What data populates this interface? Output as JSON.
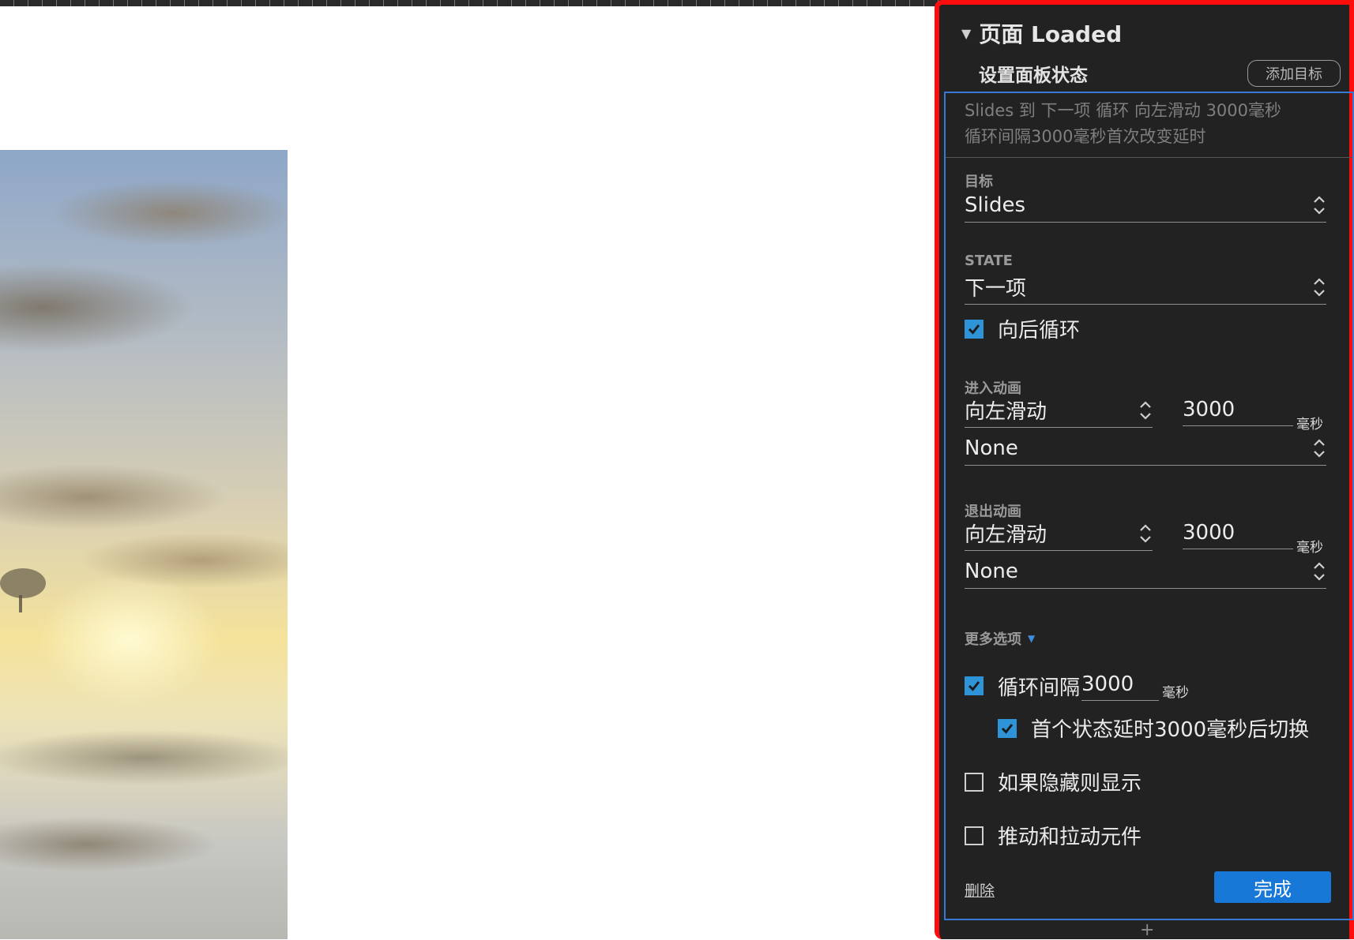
{
  "panel": {
    "header_title": "页面 Loaded",
    "sub_title": "设置面板状态",
    "add_target_label": "添加目标",
    "summary_line1": "Slides 到 下一项 循环 向左滑动 3000毫秒",
    "summary_line2": "循环间隔3000毫秒首次改变延时",
    "target_label": "目标",
    "target_value": "Slides",
    "state_label": "STATE",
    "state_value": "下一项",
    "loop_back_label": "向后循环",
    "loop_back_checked": true,
    "enter_anim_label": "进入动画",
    "enter_anim_value": "向左滑动",
    "enter_anim_ms": "3000",
    "enter_easing": "None",
    "exit_anim_label": "退出动画",
    "exit_anim_value": "向左滑动",
    "exit_anim_ms": "3000",
    "exit_easing": "None",
    "ms_unit": "毫秒",
    "more_options_label": "更多选项",
    "loop_interval_label": "循环间隔",
    "loop_interval_value": "3000",
    "loop_interval_checked": true,
    "first_delay_label": "首个状态延时3000毫秒后切换",
    "first_delay_checked": true,
    "show_if_hidden_label": "如果隐藏则显示",
    "show_if_hidden_checked": false,
    "push_pull_label": "推动和拉动元件",
    "push_pull_checked": false,
    "delete_label": "删除",
    "done_label": "完成",
    "plus_label": "+"
  },
  "colors": {
    "panel_bg": "#222222",
    "highlight_border": "#ff0d0d",
    "action_border": "#3678d4",
    "accent": "#1878d8",
    "checkbox_on": "#2f93d8"
  },
  "icons": {
    "collapse": "triangle-down-icon",
    "select": "chevron-up-down-icon",
    "check": "checkmark-icon"
  }
}
